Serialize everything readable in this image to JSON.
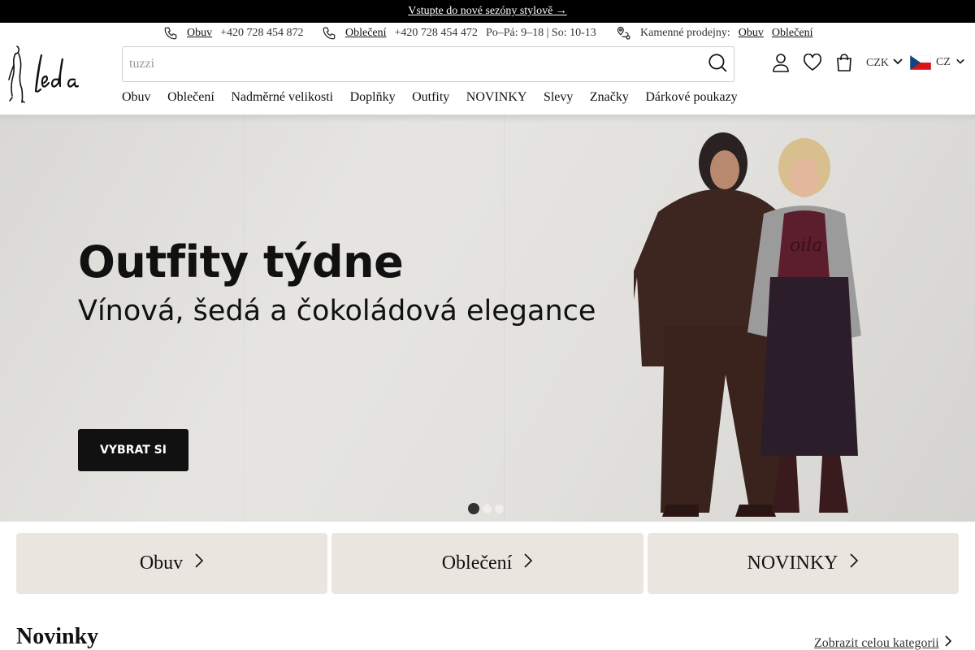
{
  "announcement": {
    "text": "Vstupte do nové sezóny stylově →"
  },
  "contact": {
    "shoes_link": "Obuv",
    "shoes_phone": "+420 728 454 872",
    "clothes_link": "Oblečení",
    "clothes_phone": "+420 728 454 472",
    "hours": "Po–Pá: 9–18 | So: 10-13",
    "stores_label": "Kamenné prodejny:",
    "stores_shoes": "Obuv",
    "stores_clothes": "Oblečení"
  },
  "header": {
    "search_placeholder": "tuzzi",
    "currency": "CZK",
    "language": "CZ"
  },
  "nav": {
    "items": [
      "Obuv",
      "Oblečení",
      "Nadměrné velikosti",
      "Doplňky",
      "Outfity",
      "NOVINKY",
      "Slevy",
      "Značky",
      "Dárkové poukazy"
    ]
  },
  "hero": {
    "title": "Outfity týdne",
    "subtitle": "Vínová, šedá a čokoládová elegance",
    "cta": "VYBRAT SI",
    "slides_total": 3,
    "active_slide": 1
  },
  "categories": [
    "Obuv",
    "Oblečení",
    "NOVINKY"
  ],
  "section": {
    "title": "Novinky",
    "more": "Zobrazit celou kategorii"
  },
  "icons": {
    "phone": "phone-icon",
    "store": "location-pin-icon",
    "search": "search-icon",
    "account": "user-icon",
    "wishlist": "heart-icon",
    "cart": "shopping-bag-icon",
    "chevron": "chevron-down-icon",
    "arrow": "chevron-right-icon",
    "flag": "czech-flag-icon"
  },
  "colors": {
    "topbar": "#000000",
    "category_tile": "#ebe5df",
    "cta_bg": "#111111"
  }
}
